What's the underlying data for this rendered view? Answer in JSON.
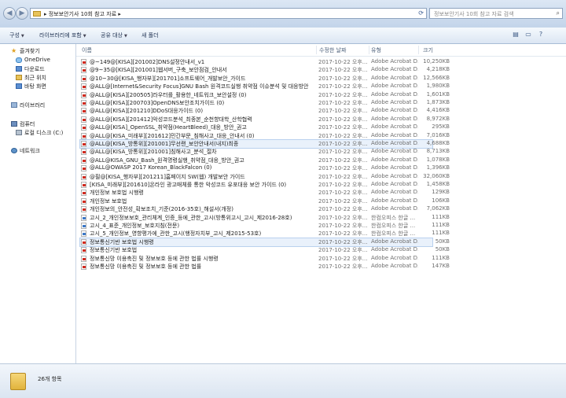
{
  "address": {
    "crumb": "▸ 정보보안기사 10회 참고 자료 ▸",
    "search_placeholder": "정보보안기사 10회 참고 자료 검색"
  },
  "toolbar": {
    "organize": "구성",
    "include_library": "라이브러리에 포함",
    "share": "공유 대상",
    "new_folder": "새 폴더"
  },
  "nav": {
    "favorites": "즐겨찾기",
    "onedrive": "OneDrive",
    "downloads": "다운로드",
    "recent": "최근 위치",
    "desktop": "바탕 화면",
    "libraries": "라이브러리",
    "computer": "컴퓨터",
    "local_disk": "로컬 디스크 (C:)",
    "network": "네트워크"
  },
  "columns": {
    "name": "이름",
    "date": "수정한 날짜",
    "type": "유형",
    "size": "크기"
  },
  "files": [
    {
      "name": "@~149@[KISA][201002]DNS설정안내서_v1",
      "date": "2017-10-22 오후...",
      "type": "Adobe Acrobat D...",
      "size": "10,250KB",
      "icon": "pdf"
    },
    {
      "name": "@9~35@[KISA][201001]웹서버_구축_보안점검_안내서",
      "date": "2017-10-22 오후...",
      "type": "Adobe Acrobat D...",
      "size": "4,218KB",
      "icon": "pdf"
    },
    {
      "name": "@10~30@[KISA_행자부][201701]소프트웨어_개발보안_가이드",
      "date": "2017-10-22 오후...",
      "type": "Adobe Acrobat D...",
      "size": "12,566KB",
      "icon": "pdf"
    },
    {
      "name": "@ALL@[Internet&Security Focus]GNU Bash 원격코드실행 취약점 이슈분석 및 대응방안",
      "date": "2017-10-22 오후...",
      "type": "Adobe Acrobat D...",
      "size": "1,980KB",
      "icon": "pdf"
    },
    {
      "name": "@ALL@[KISA][200505]라우터를_활용한_네트워크_보안설정 (0)",
      "date": "2017-10-22 오후...",
      "type": "Adobe Acrobat D...",
      "size": "1,601KB",
      "icon": "pdf"
    },
    {
      "name": "@ALL@[KISA][200703]OpenDNS보안조치가이드 (0)",
      "date": "2017-10-22 오후...",
      "type": "Adobe Acrobat D...",
      "size": "1,873KB",
      "icon": "pdf"
    },
    {
      "name": "@ALL@[KISA][201210]DDoS대응가이드 (0)",
      "date": "2017-10-22 오후...",
      "type": "Adobe Acrobat D...",
      "size": "4,416KB",
      "icon": "pdf"
    },
    {
      "name": "@ALL@[KISA][201412]악성코드분석_최종본_순천향대학_산학협력",
      "date": "2017-10-22 오후...",
      "type": "Adobe Acrobat D...",
      "size": "8,972KB",
      "icon": "pdf"
    },
    {
      "name": "@ALL@[KISA]_OpenSSL_취약점(HeartBleed)_대응_방안_권고",
      "date": "2017-10-22 오후...",
      "type": "Adobe Acrobat D...",
      "size": "295KB",
      "icon": "pdf"
    },
    {
      "name": "@ALL@[KISA_미래부][201612]민간부문_침해사고_대응_안내서 (0)",
      "date": "2017-10-22 오후...",
      "type": "Adobe Acrobat D...",
      "size": "7,016KB",
      "icon": "pdf"
    },
    {
      "name": "@ALL@[KISA_방통위][201001]무선랜_보안안내서(내지)최종",
      "date": "2017-10-22 오후...",
      "type": "Adobe Acrobat D...",
      "size": "4,688KB",
      "icon": "pdf",
      "selected": true
    },
    {
      "name": "@ALL@[KISA_방통위][201001]침해사고_분석_절차",
      "date": "2017-10-22 오후...",
      "type": "Adobe Acrobat D...",
      "size": "8,713KB",
      "icon": "pdf"
    },
    {
      "name": "@ALL@KISA_GNU_Bash_원격명령실행_취약점_대응_방안_권고",
      "date": "2017-10-22 오후...",
      "type": "Adobe Acrobat D...",
      "size": "1,078KB",
      "icon": "pdf"
    },
    {
      "name": "@ALL@OWASP 2017 Korean_BlackFalcon (0)",
      "date": "2017-10-22 오후...",
      "type": "Adobe Acrobat D...",
      "size": "1,396KB",
      "icon": "pdf"
    },
    {
      "name": "@필@[KISA_행자부][201211]홈페이지 SW(웹) 개발보안 가이드",
      "date": "2017-10-22 오후...",
      "type": "Adobe Acrobat D...",
      "size": "32,060KB",
      "icon": "pdf"
    },
    {
      "name": "[KISA_미래부][201610]온라인 광고매체를 통한 악성코드 유포대응 보안 가이드 (0)",
      "date": "2017-10-22 오후...",
      "type": "Adobe Acrobat D...",
      "size": "1,458KB",
      "icon": "pdf"
    },
    {
      "name": "개인정보 보호법 시행령",
      "date": "2017-10-22 오후...",
      "type": "Adobe Acrobat D...",
      "size": "129KB",
      "icon": "pdf"
    },
    {
      "name": "개인정보 보호법",
      "date": "2017-10-22 오후...",
      "type": "Adobe Acrobat D...",
      "size": "106KB",
      "icon": "pdf"
    },
    {
      "name": "개인정보의_안전성_확보조치_기준(2016-35호)_해설서(개정)",
      "date": "2017-10-22 오후...",
      "type": "Adobe Acrobat D...",
      "size": "7,062KB",
      "icon": "pdf"
    },
    {
      "name": "고시_2_개인정보보호_관리체계_인증_등에_관한_고시(방통위고시_고시_제2016-28호)",
      "date": "2017-10-22 오후...",
      "type": "한컴오피스 한글 ...",
      "size": "111KB",
      "icon": "hwp"
    },
    {
      "name": "고시_4_표준_개인정보_보호지침(전문)",
      "date": "2017-10-22 오후...",
      "type": "한컴오피스 한글 ...",
      "size": "111KB",
      "icon": "hwp"
    },
    {
      "name": "고시_5_개인정보_영향평가에_관한_고시(행정자치부_고시_제2015-53호)",
      "date": "2017-10-22 오후...",
      "type": "한컴오피스 한글 ...",
      "size": "111KB",
      "icon": "hwp"
    },
    {
      "name": "정보통신기반 보호법 시행령",
      "date": "2017-10-22 오후...",
      "type": "Adobe Acrobat D...",
      "size": "50KB",
      "icon": "pdf",
      "selected": true
    },
    {
      "name": "정보통신기반 보호법",
      "date": "2017-10-22 오후...",
      "type": "Adobe Acrobat D...",
      "size": "50KB",
      "icon": "pdf"
    },
    {
      "name": "정보통신망 이용촉진 및 정보보호 등에 관한 법률 시행령",
      "date": "2017-10-22 오후...",
      "type": "Adobe Acrobat D...",
      "size": "111KB",
      "icon": "pdf"
    },
    {
      "name": "정보통신망 이용촉진 및 정보보호 등에 관한 법률",
      "date": "2017-10-22 오후...",
      "type": "Adobe Acrobat D...",
      "size": "147KB",
      "icon": "pdf"
    }
  ],
  "status": {
    "count": "26개 항목"
  }
}
